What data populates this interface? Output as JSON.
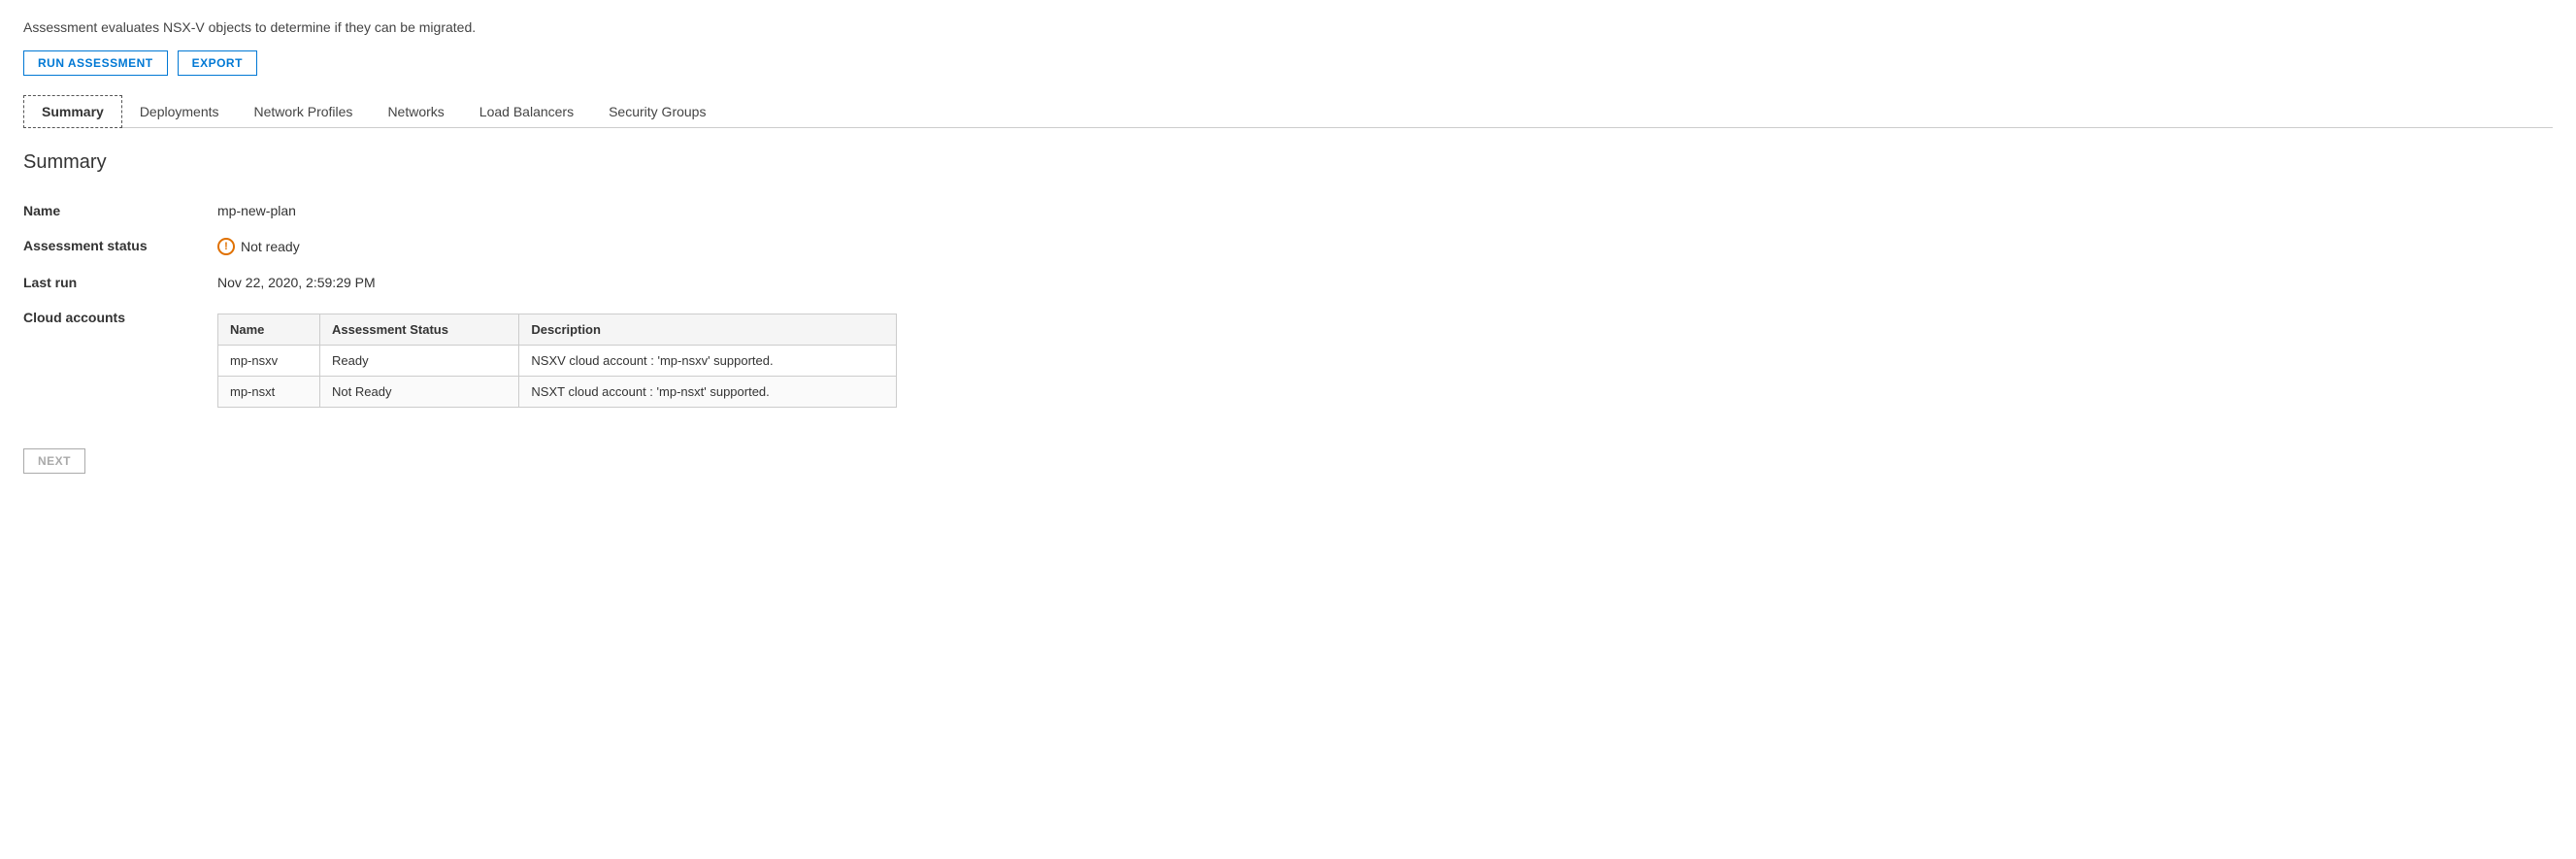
{
  "description": "Assessment evaluates NSX-V objects to determine if they can be migrated.",
  "toolbar": {
    "run_assessment_label": "RUN ASSESSMENT",
    "export_label": "EXPORT"
  },
  "tabs": [
    {
      "id": "summary",
      "label": "Summary",
      "active": true
    },
    {
      "id": "deployments",
      "label": "Deployments",
      "active": false
    },
    {
      "id": "network-profiles",
      "label": "Network Profiles",
      "active": false
    },
    {
      "id": "networks",
      "label": "Networks",
      "active": false
    },
    {
      "id": "load-balancers",
      "label": "Load Balancers",
      "active": false
    },
    {
      "id": "security-groups",
      "label": "Security Groups",
      "active": false
    }
  ],
  "section_title": "Summary",
  "fields": {
    "name_label": "Name",
    "name_value": "mp-new-plan",
    "assessment_status_label": "Assessment status",
    "assessment_status_value": "Not ready",
    "last_run_label": "Last run",
    "last_run_value": "Nov 22, 2020, 2:59:29 PM",
    "cloud_accounts_label": "Cloud accounts"
  },
  "cloud_accounts_table": {
    "columns": [
      "Name",
      "Assessment Status",
      "Description"
    ],
    "rows": [
      {
        "name": "mp-nsxv",
        "assessment_status": "Ready",
        "description": "NSXV cloud account : 'mp-nsxv' supported."
      },
      {
        "name": "mp-nsxt",
        "assessment_status": "Not Ready",
        "description": "NSXT cloud account : 'mp-nsxt' supported."
      }
    ]
  },
  "next_button_label": "NEXT",
  "colors": {
    "accent": "#0078d4",
    "warning": "#e07000"
  }
}
